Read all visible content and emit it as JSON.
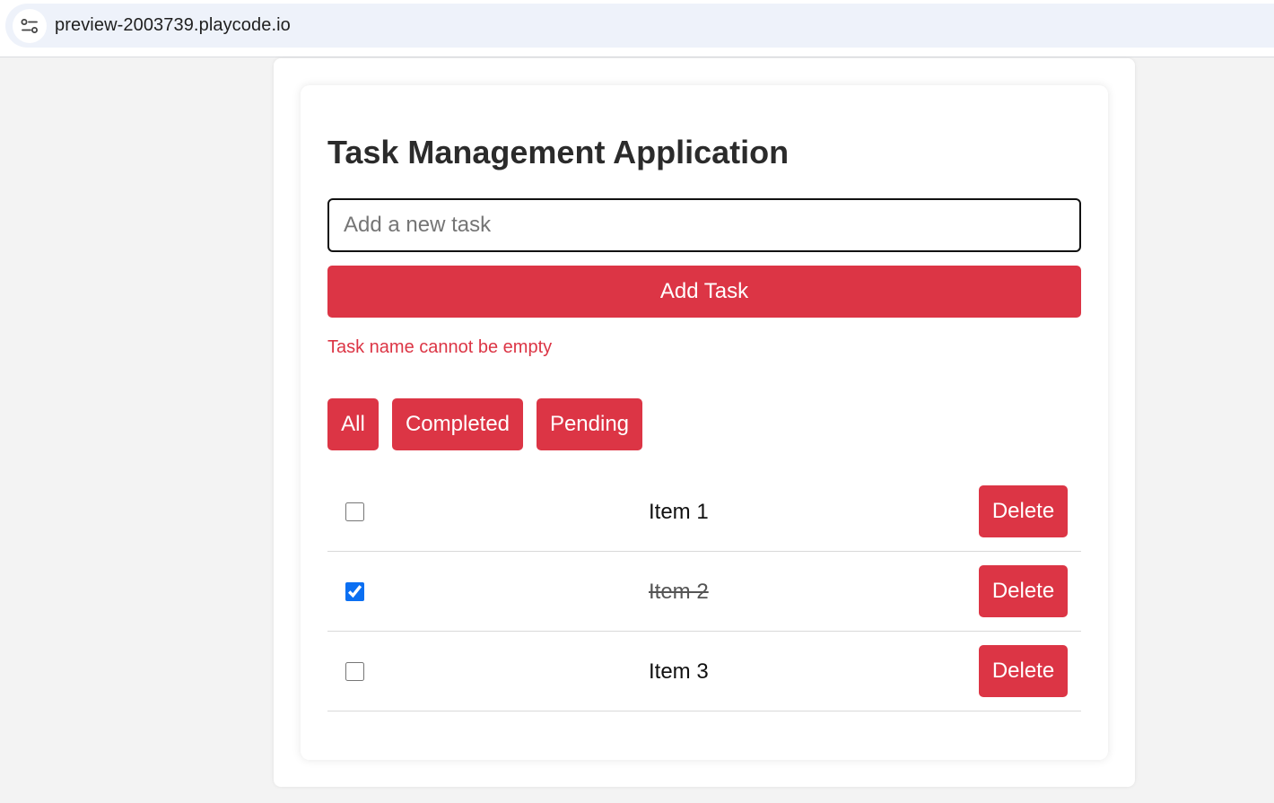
{
  "browser": {
    "url": "preview-2003739.playcode.io",
    "site_info_icon": "tune-icon"
  },
  "app": {
    "title": "Task Management Application",
    "input_placeholder": "Add a new task",
    "input_value": "",
    "add_button_label": "Add Task",
    "error_message": "Task name cannot be empty",
    "filters": [
      {
        "label": "All"
      },
      {
        "label": "Completed"
      },
      {
        "label": "Pending"
      }
    ],
    "tasks": [
      {
        "label": "Item 1",
        "completed": false,
        "delete_label": "Delete"
      },
      {
        "label": "Item 2",
        "completed": true,
        "delete_label": "Delete"
      },
      {
        "label": "Item 3",
        "completed": false,
        "delete_label": "Delete"
      }
    ]
  },
  "colors": {
    "accent": "#dc3545",
    "page_background": "#f3f3f3",
    "checkbox_accent": "#0b6ff2"
  }
}
